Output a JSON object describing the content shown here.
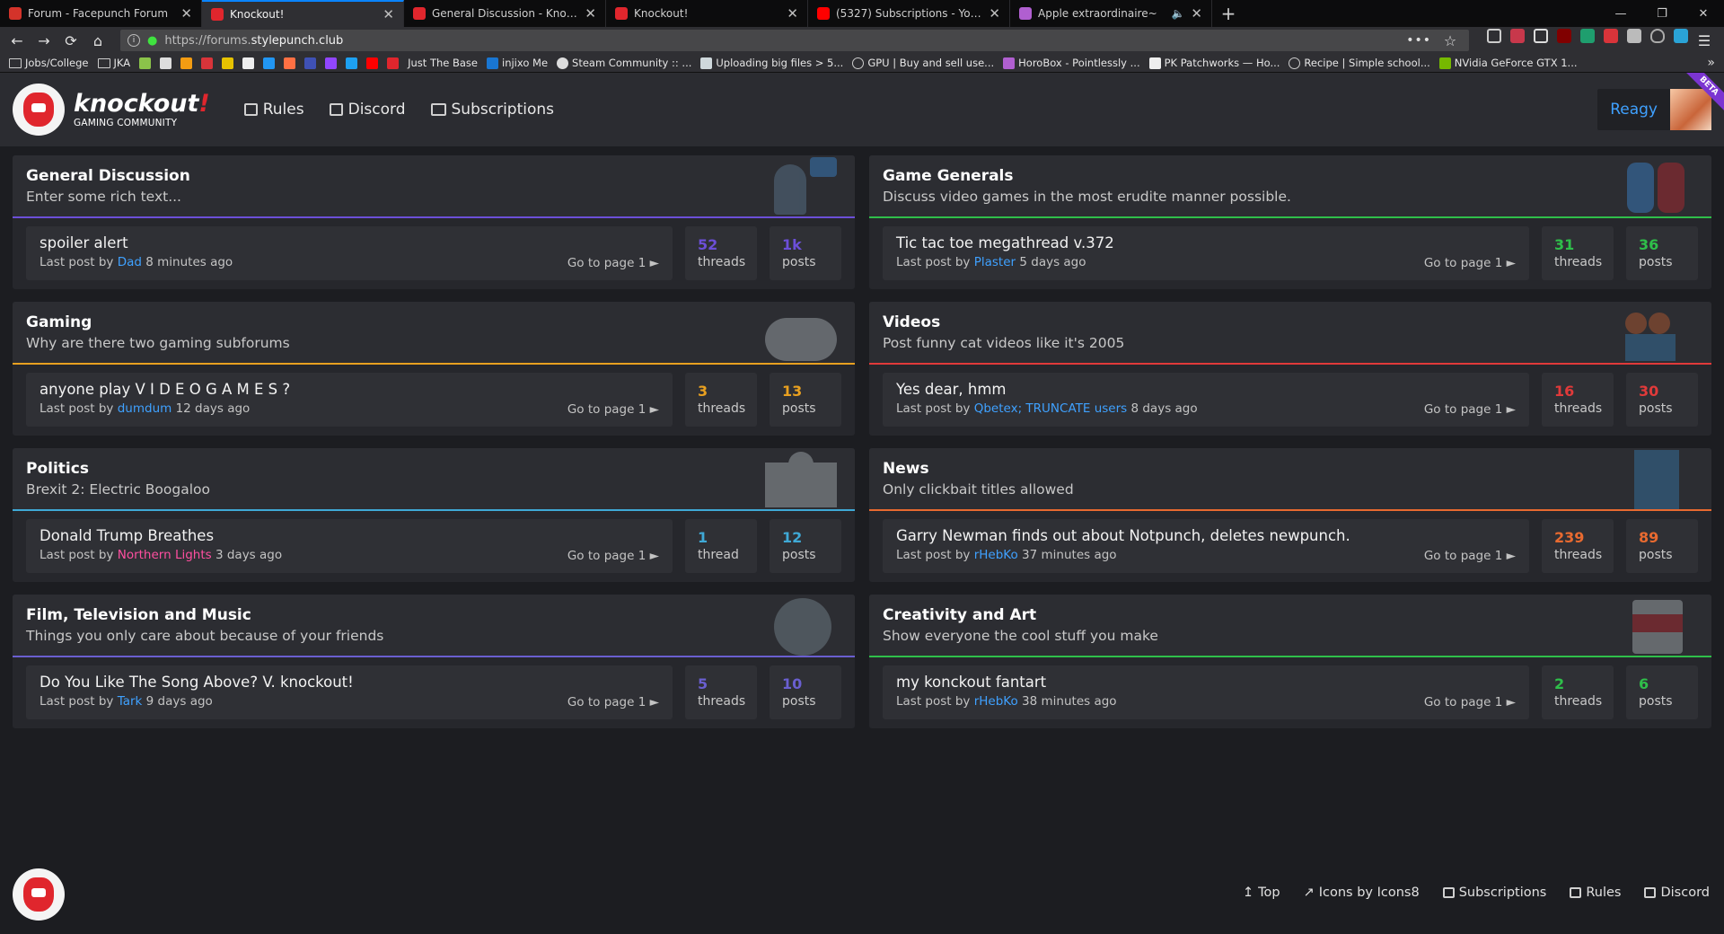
{
  "browser": {
    "tabs": [
      {
        "title": "Forum - Facepunch Forum",
        "color": "#d4332a",
        "active": false
      },
      {
        "title": "Knockout!",
        "color": "#e0262d",
        "active": true
      },
      {
        "title": "General Discussion - Knockout!",
        "color": "#e0262d",
        "active": false
      },
      {
        "title": "Knockout!",
        "color": "#e0262d",
        "active": false
      },
      {
        "title": "(5327) Subscriptions - YouTube",
        "color": "#ff0000",
        "active": false
      },
      {
        "title": "Apple extraordinaire~",
        "color": "#b05fd0",
        "active": false
      }
    ],
    "url_dim": "https://forums.",
    "url_host": "stylepunch.club",
    "bookmarks": [
      "Jobs/College",
      "JKA",
      "Just The Base",
      "injixo Me",
      "Steam Community :: ...",
      "Uploading big files > 5...",
      "GPU | Buy and sell use...",
      "HoroBox - Pointlessly ...",
      "PK Patchworks — Ho...",
      "Recipe | Simple school...",
      "NVidia GeForce GTX 1..."
    ]
  },
  "site": {
    "logo_name": "knockout",
    "logo_bang": "!",
    "logo_sub": "GAMING COMMUNITY",
    "nav": [
      "Rules",
      "Discord",
      "Subscriptions"
    ],
    "username": "Reagy",
    "beta": "BETA"
  },
  "subforums": [
    {
      "name": "General Discussion",
      "desc": "Enter some rich text...",
      "accent": "#6c4fd8",
      "thread": "spoiler alert",
      "last_by": "Dad",
      "last_by_color": "blue",
      "last_when": "8 minutes ago",
      "goto": "Go to page 1",
      "threads": "52",
      "threads_label": "threads",
      "posts": "1k",
      "posts_label": "posts"
    },
    {
      "name": "Game Generals",
      "desc": "Discuss video games in the most erudite manner possible.",
      "accent": "#2fbf4a",
      "thread": "Tic tac toe megathread v.372",
      "last_by": "Plaster",
      "last_by_color": "blue",
      "last_when": "5 days ago",
      "goto": "Go to page 1",
      "threads": "31",
      "threads_label": "threads",
      "posts": "36",
      "posts_label": "posts"
    },
    {
      "name": "Gaming",
      "desc": "Why are there two gaming subforums",
      "accent": "#e8a020",
      "thread": "anyone play V I D E O G A M E S ?",
      "last_by": "dumdum",
      "last_by_color": "blue",
      "last_when": "12 days ago",
      "goto": "Go to page 1",
      "threads": "3",
      "threads_label": "threads",
      "posts": "13",
      "posts_label": "posts"
    },
    {
      "name": "Videos",
      "desc": "Post funny cat videos like it's 2005",
      "accent": "#e03a3a",
      "thread": "Yes dear, hmm",
      "last_by": "Qbetex; TRUNCATE users",
      "last_by_color": "blue",
      "last_when": "8 days ago",
      "goto": "Go to page 1",
      "threads": "16",
      "threads_label": "threads",
      "posts": "30",
      "posts_label": "posts"
    },
    {
      "name": "Politics",
      "desc": "Brexit 2: Electric Boogaloo",
      "accent": "#3fa9d6",
      "thread": "Donald Trump Breathes",
      "last_by": "Northern Lights",
      "last_by_color": "pink",
      "last_when": "3 days ago",
      "goto": "Go to page 1",
      "threads": "1",
      "threads_label": "thread",
      "posts": "12",
      "posts_label": "posts"
    },
    {
      "name": "News",
      "desc": "Only clickbait titles allowed",
      "accent": "#e86a30",
      "thread": "Garry Newman finds out about Notpunch, deletes newpunch.",
      "last_by": "rHebKo",
      "last_by_color": "blue",
      "last_when": "37 minutes ago",
      "goto": "Go to page 1",
      "threads": "239",
      "threads_label": "threads",
      "posts": "89",
      "posts_label": "posts"
    },
    {
      "name": "Film, Television and Music",
      "desc": "Things you only care about because of your friends",
      "accent": "#6a5fd0",
      "thread": "Do You Like The Song Above? V. knockout!",
      "last_by": "Tark",
      "last_by_color": "blue",
      "last_when": "9 days ago",
      "goto": "Go to page 1",
      "threads": "5",
      "threads_label": "threads",
      "posts": "10",
      "posts_label": "posts"
    },
    {
      "name": "Creativity and Art",
      "desc": "Show everyone the cool stuff you make",
      "accent": "#2fbf4a",
      "thread": "my konckout fantart",
      "last_by": "rHebKo",
      "last_by_color": "blue",
      "last_when": "38 minutes ago",
      "goto": "Go to page 1",
      "threads": "2",
      "threads_label": "threads",
      "posts": "6",
      "posts_label": "posts"
    }
  ],
  "footer": {
    "links": [
      "Top",
      "Icons by Icons8",
      "Subscriptions",
      "Rules",
      "Discord"
    ]
  }
}
